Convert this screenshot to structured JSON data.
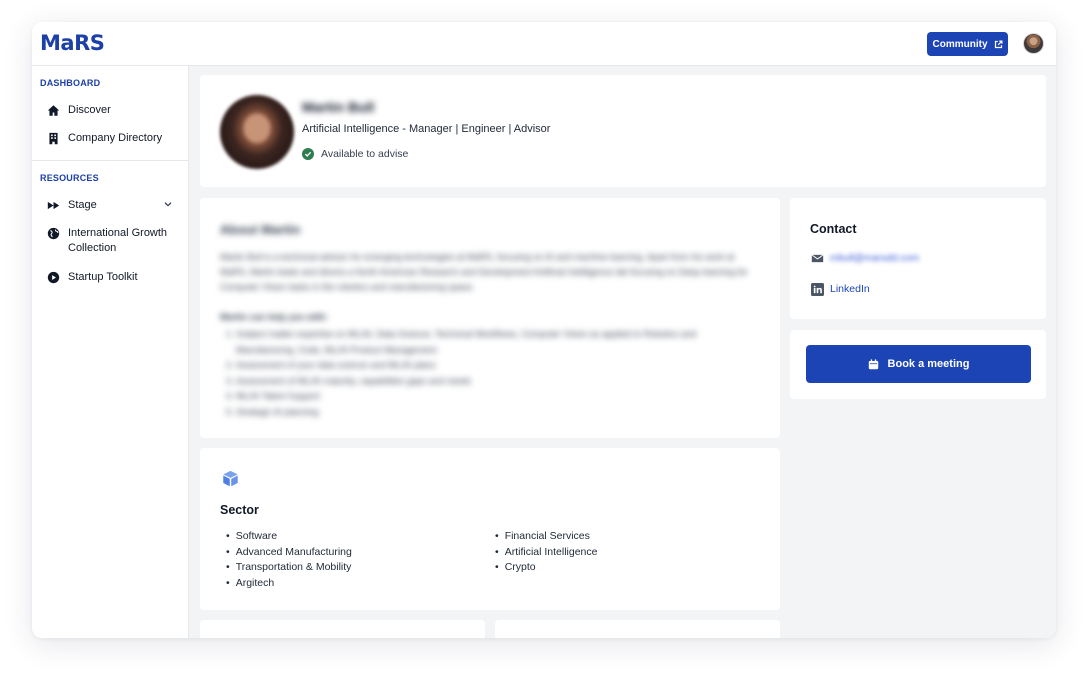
{
  "header": {
    "logo": "MaRS",
    "community_label": "Community"
  },
  "sidebar": {
    "dashboard_heading": "DASHBOARD",
    "dashboard_items": [
      {
        "label": "Discover",
        "icon": "home-icon"
      },
      {
        "label": "Company Directory",
        "icon": "building-icon"
      }
    ],
    "resources_heading": "RESOURCES",
    "resource_items": [
      {
        "label": "Stage",
        "icon": "fast-forward-icon"
      },
      {
        "label": "International Growth Collection",
        "icon": "globe-icon"
      },
      {
        "label": "Startup Toolkit",
        "icon": "play-circle-icon"
      }
    ]
  },
  "profile": {
    "name": "Martin Bull",
    "tagline": "Artificial Intelligence - Manager | Engineer | Advisor",
    "availability": "Available to advise"
  },
  "about": {
    "title": "About Martin",
    "paragraph": "Martin Bull is a technical advisor for emerging technologies at MaRS, focusing on AI and machine learning. Apart from his work at MaRS, Martin leads and directs a North American Research and Development Artificial Intelligence lab focusing on Deep learning for Computer Vision tasks in the robotics and manufacturing space.",
    "help_title": "Martin can help you with:",
    "help_items": [
      "Subject matter expertise on ML/AI, Data Science, Technical Workflows, Computer Vision as applied to Robotics and Manufacturing, Code, ML/AI Product Management",
      "Assessment of your data science and ML/AI plans",
      "Assessment of ML/AI maturity, capabilities gaps and needs",
      "ML/AI Talent Support",
      "Strategic AI planning"
    ]
  },
  "sector": {
    "title": "Sector",
    "col1": [
      "Software",
      "Advanced Manufacturing",
      "Transportation & Mobility",
      "Argitech"
    ],
    "col2": [
      "Financial Services",
      "Artificial Intelligence",
      "Crypto"
    ]
  },
  "contact": {
    "title": "Contact",
    "email": "mbull@marsdd.com",
    "linkedin": "LinkedIn"
  },
  "booking": {
    "label": "Book a meeting"
  },
  "colors": {
    "brand": "#1c44b4",
    "success": "#2e7d4f"
  }
}
